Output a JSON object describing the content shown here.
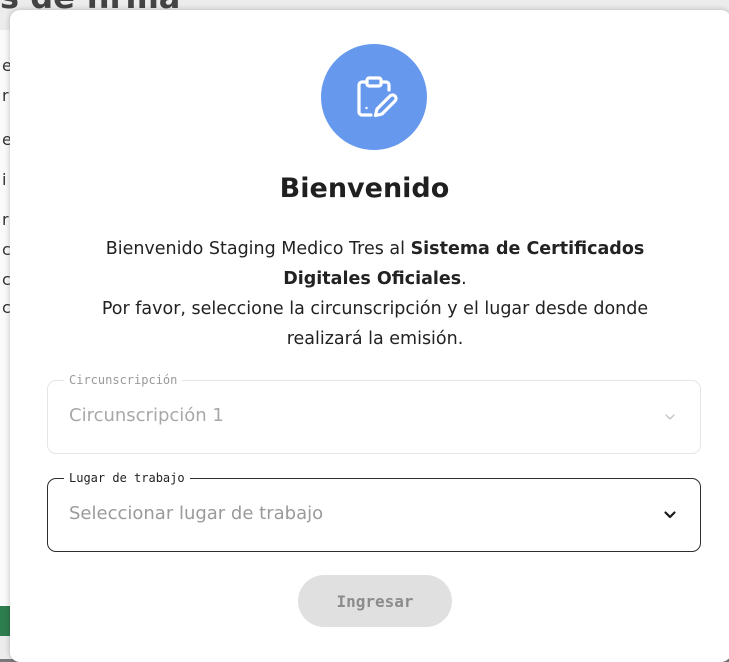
{
  "background": {
    "title_fragment": "s de firma",
    "edge_chars": [
      "e",
      "r",
      "e",
      "i",
      "r",
      "c",
      "c",
      "c"
    ]
  },
  "modal": {
    "icon": "clipboard-edit-icon",
    "title": "Bienvenido",
    "intro_prefix": "Bienvenido Staging Medico Tres al ",
    "intro_bold": "Sistema de Certificados Digitales Oficiales",
    "intro_suffix": ".",
    "instruction": "Por favor, seleccione la circunscripción y el lugar desde donde realizará la emisión.",
    "circunscripcion": {
      "label": "Circunscripción",
      "value": "Circunscripción 1",
      "disabled": true
    },
    "lugar": {
      "label": "Lugar de trabajo",
      "placeholder": "Seleccionar lugar de trabajo"
    },
    "submit_label": "Ingresar"
  },
  "colors": {
    "badge": "#6699ee",
    "button_bg": "#e0e0e0",
    "button_text": "#8c8c8c"
  }
}
